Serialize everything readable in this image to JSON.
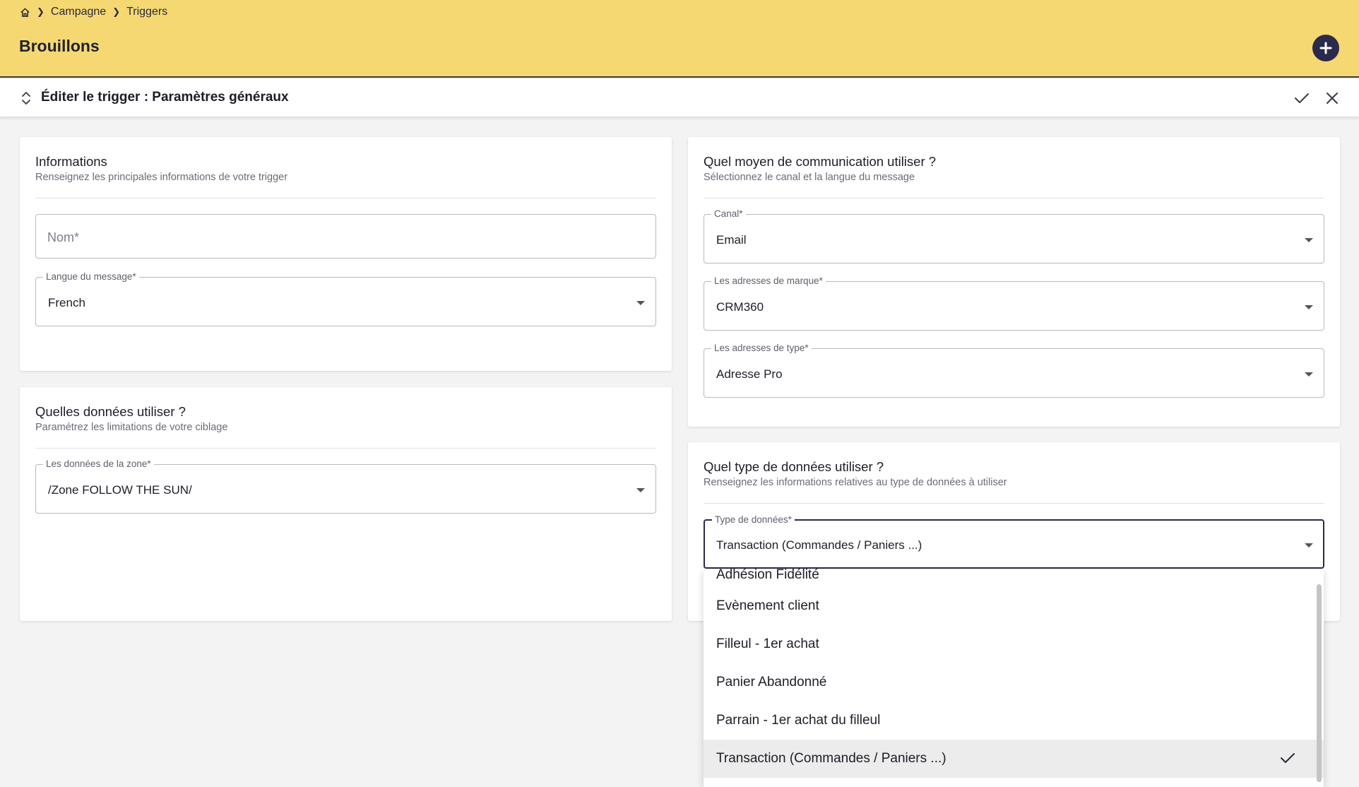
{
  "breadcrumb": {
    "home_icon": "home-icon",
    "items": [
      "Campagne",
      "Triggers"
    ]
  },
  "header": {
    "title": "Brouillons",
    "add_icon": "plus-icon"
  },
  "edit_bar": {
    "title": "Éditer le trigger : Paramètres généraux",
    "icons": [
      "sort-icon",
      "check-icon",
      "close-icon"
    ]
  },
  "informations": {
    "title": "Informations",
    "subtitle": "Renseignez les principales informations de votre trigger",
    "nom_placeholder": "Nom*",
    "langue_label": "Langue du message*",
    "langue_value": "French"
  },
  "donnees": {
    "title": "Quelles données utiliser ?",
    "subtitle": "Paramétrez les limitations de votre ciblage",
    "zone_label": "Les données de la zone*",
    "zone_value": "/Zone FOLLOW THE SUN/"
  },
  "communication": {
    "title": "Quel moyen de communication utiliser ?",
    "subtitle": "Sélectionnez le canal et la langue du message",
    "canal_label": "Canal*",
    "canal_value": "Email",
    "marque_label": "Les adresses de marque*",
    "marque_value": "CRM360",
    "type_label": "Les adresses de type*",
    "type_value": "Adresse Pro"
  },
  "type_donnees": {
    "title": "Quel type de données utiliser ?",
    "subtitle": "Renseignez les informations relatives au type de données à utiliser",
    "label": "Type de données*",
    "value": "Transaction (Commandes / Paniers ...)"
  },
  "dropdown": {
    "options": [
      "Adhésion Fidélité",
      "Evènement client",
      "Filleul - 1er achat",
      "Panier Abandonné",
      "Parrain - 1er achat du filleul",
      "Transaction (Commandes / Paniers ...)"
    ],
    "selected": "Transaction (Commandes / Paniers ...)"
  },
  "colors": {
    "header_bg": "#f6d873",
    "accent": "#2b2a4a",
    "selected_bg": "#ececec"
  }
}
